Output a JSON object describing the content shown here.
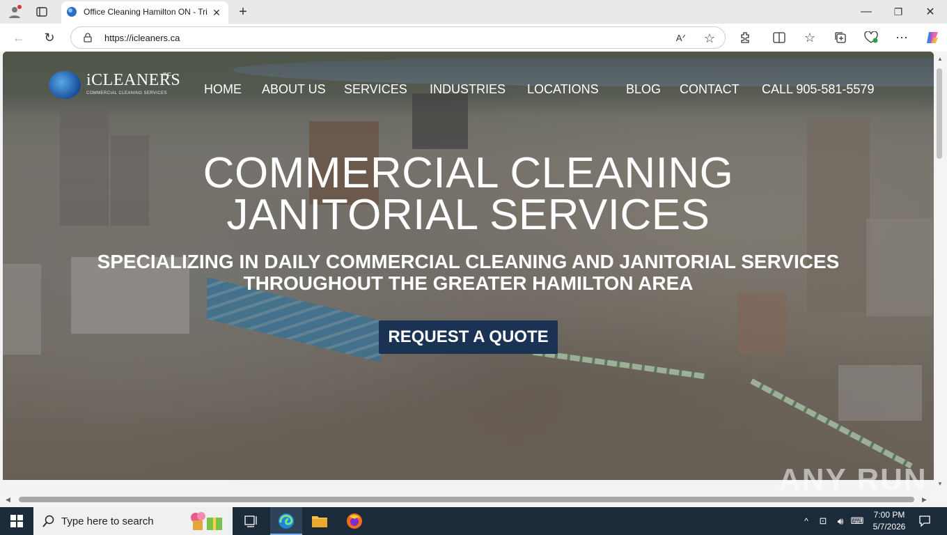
{
  "browser": {
    "tab_title": "Office Cleaning Hamilton ON - Tri",
    "url": "https://icleaners.ca"
  },
  "site": {
    "logo_text": "iCLEANERS",
    "logo_inc": "INC.",
    "logo_sub": "COMMERCIAL CLEANING SERVICES",
    "nav": [
      "HOME",
      "ABOUT US",
      "SERVICES",
      "INDUSTRIES",
      "LOCATIONS",
      "BLOG",
      "CONTACT",
      "CALL 905-581-5579"
    ],
    "hero_title_line1": "COMMERCIAL CLEANING",
    "hero_title_line2": "JANITORIAL SERVICES",
    "hero_sub_line1": "SPECIALIZING IN DAILY COMMERCIAL CLEANING AND JANITORIAL SERVICES",
    "hero_sub_line2": "THROUGHOUT THE GREATER HAMILTON AREA",
    "cta_label": "REQUEST A QUOTE",
    "watermark": "ANY RUN"
  },
  "taskbar": {
    "search_placeholder": "Type here to search",
    "time": "7:00 PM",
    "date": "5/7/2026"
  }
}
